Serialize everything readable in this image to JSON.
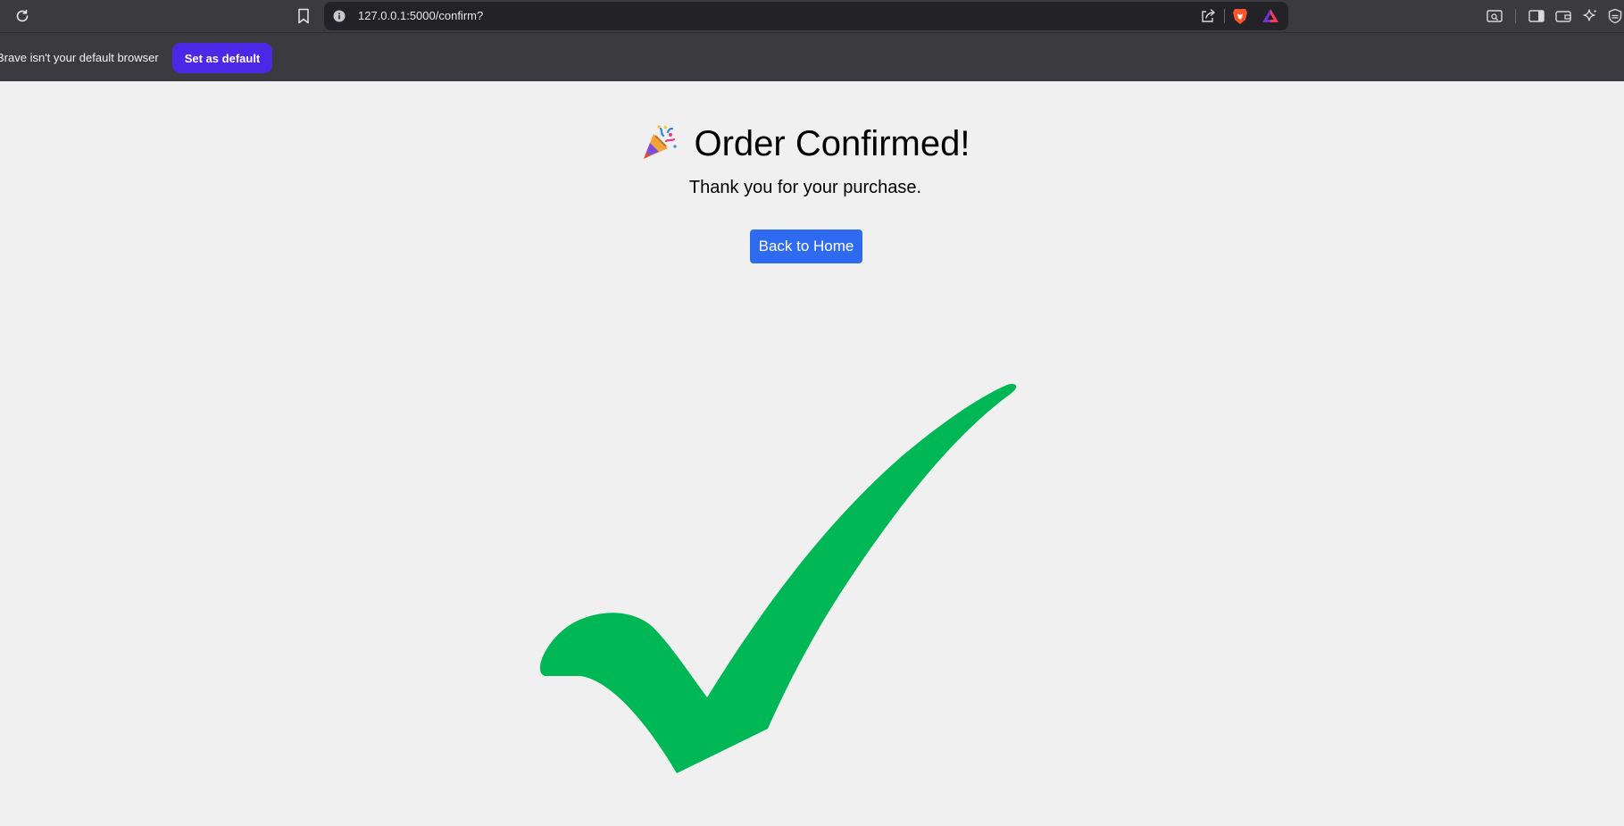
{
  "browser": {
    "url": "127.0.0.1:5000/confirm?",
    "icons": [
      "reload-icon",
      "bookmark-icon",
      "site-info-icon",
      "share-icon",
      "brave-shield-icon",
      "brave-rewards-icon",
      "tab-search-icon",
      "sidebar-icon",
      "wallet-icon",
      "leo-ai-icon",
      "vpn-icon"
    ]
  },
  "infobar": {
    "message": "Brave isn't your default browser",
    "button_label": "Set as default"
  },
  "page": {
    "title": "Order Confirmed!",
    "subtitle": "Thank you for your purchase.",
    "home_button_label": "Back to Home",
    "title_icon": "party-popper-icon",
    "graphic": "checkmark-icon"
  },
  "colors": {
    "checkmark": "#00b755",
    "button": "#2f6bf1",
    "set_default_button": "#4b28e6",
    "background": "#f0f0f0"
  }
}
